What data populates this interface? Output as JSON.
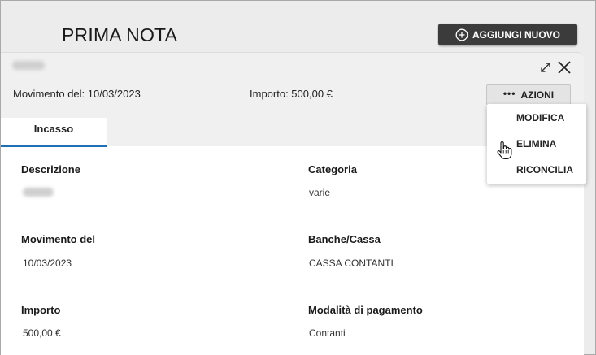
{
  "header": {
    "title": "PRIMA NOTA",
    "add_button_label": "AGGIUNGI NUOVO"
  },
  "record": {
    "movimento_text": "Movimento del: 10/03/2023",
    "importo_text": "Importo: 500,00 €",
    "actions_label": "AZIONI",
    "actions_menu": [
      "MODIFICA",
      "ELIMINA",
      "RICONCILIA"
    ]
  },
  "tabs": [
    {
      "label": "Incasso",
      "active": true
    }
  ],
  "fields": {
    "descrizione_label": "Descrizione",
    "categoria_label": "Categoria",
    "categoria_value": "varie",
    "movimento_label": "Movimento del",
    "movimento_value": "10/03/2023",
    "banche_label": "Banche/Cassa",
    "banche_value": "CASSA CONTANTI",
    "importo_label": "Importo",
    "importo_value": "500,00 €",
    "modalita_label": "Modalità di pagamento",
    "modalita_value": "Contanti"
  },
  "colors": {
    "accent_tab": "#1f6fb5",
    "add_button_bg": "#3b3b3b",
    "page_bg": "#ececec",
    "card_head_bg": "#f0f0f0"
  },
  "icons": {
    "add": "plus-circle-icon",
    "expand": "expand-arrows-icon",
    "close": "close-icon",
    "actions": "ellipsis-icon",
    "cursor": "hand-pointer-icon"
  }
}
